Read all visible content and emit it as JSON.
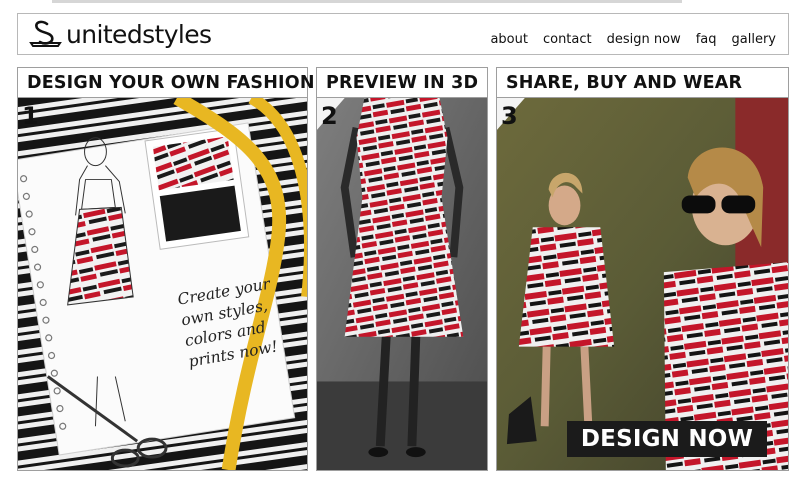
{
  "brand": {
    "name": "unitedstyles",
    "logo_icon": "hanger-s-icon"
  },
  "nav": {
    "items": [
      {
        "label": "about"
      },
      {
        "label": "contact"
      },
      {
        "label": "design now"
      },
      {
        "label": "faq"
      },
      {
        "label": "gallery"
      }
    ]
  },
  "panels": [
    {
      "title": "DESIGN YOUR OWN FASHION",
      "step": "1",
      "caption": "Create your own styles, colors and prints now!"
    },
    {
      "title": "PREVIEW IN 3D",
      "step": "2"
    },
    {
      "title": "SHARE, BUY AND WEAR",
      "step": "3",
      "cta_label": "DESIGN NOW"
    }
  ],
  "colors": {
    "accent_red": "#c4162a",
    "stripe_black": "#161616",
    "tape_yellow": "#e8b722",
    "border": "#9e9e9e"
  }
}
